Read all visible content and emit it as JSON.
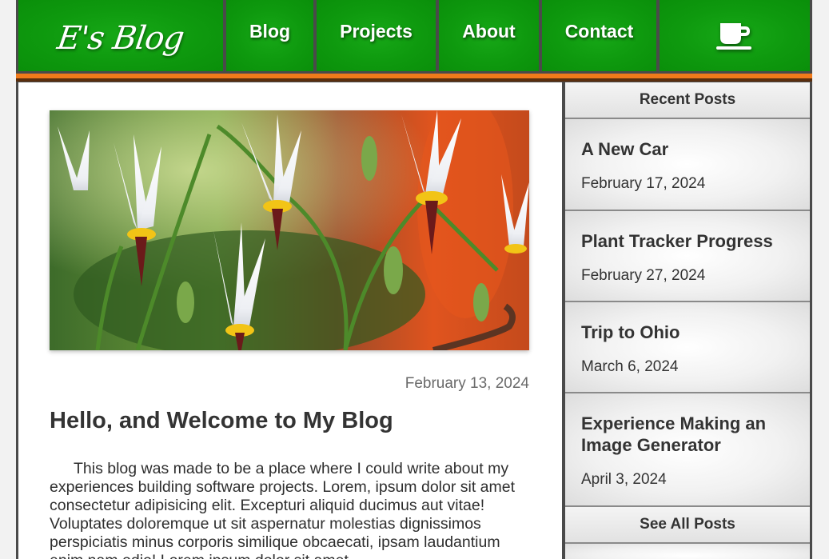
{
  "nav": {
    "logo": "E's Blog",
    "items": [
      "Blog",
      "Projects",
      "About",
      "Contact"
    ],
    "coffee_icon": "coffee-cup-icon"
  },
  "article": {
    "image_subject": "white shooting star flowers",
    "date": "February 13, 2024",
    "title": "Hello, and Welcome to My Blog",
    "body": "This blog was made to be a place where I could write about my experiences building software projects. Lorem, ipsum dolor sit amet consectetur adipisicing elit. Excepturi aliquid ducimus aut vitae! Voluptates doloremque ut sit aspernatur molestias dignissimos perspiciatis minus corporis similique obcaecati, ipsam laudantium enim nam odio! Lorem ipsum dolor sit amet"
  },
  "sidebar": {
    "header": "Recent Posts",
    "posts": [
      {
        "title": "A New Car",
        "date": "February 17, 2024"
      },
      {
        "title": "Plant Tracker Progress",
        "date": "February 27, 2024"
      },
      {
        "title": "Trip to Ohio",
        "date": "March 6, 2024"
      },
      {
        "title": "Experience Making an Image Generator",
        "date": "April 3, 2024"
      }
    ],
    "see_all": "See All Posts"
  },
  "colors": {
    "nav_green": "#0e990e",
    "accent_orange": "#f07a1a",
    "accent_brown": "#5a2e0e",
    "frame_gray": "#4a4a4a"
  }
}
